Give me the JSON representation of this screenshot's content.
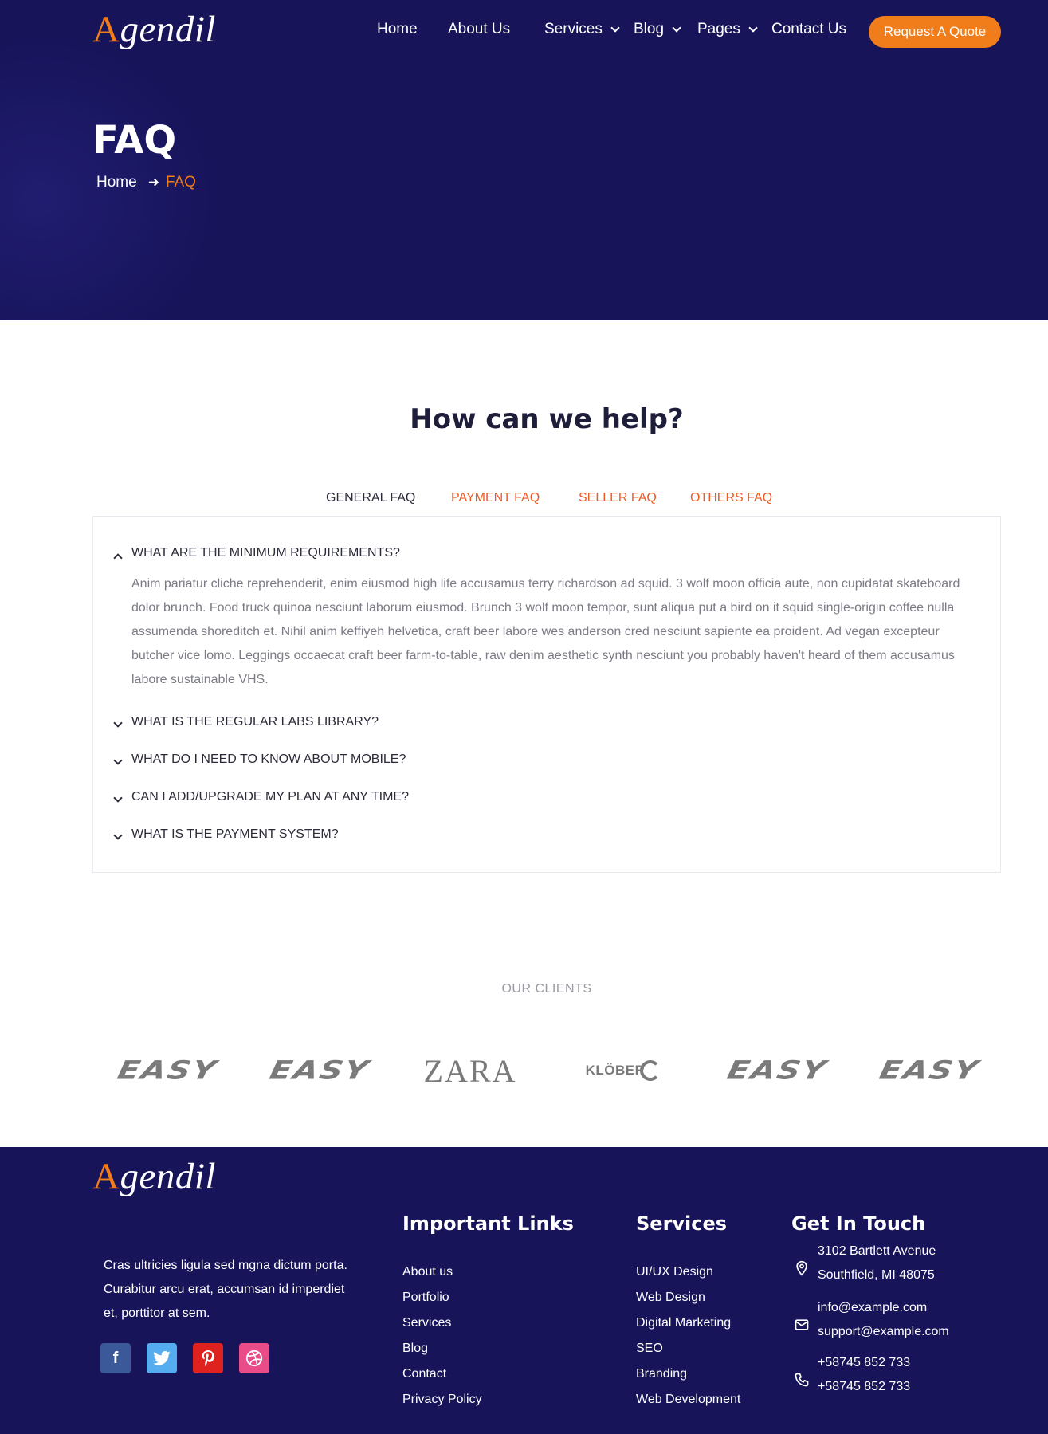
{
  "brand": {
    "logo_initial": "A",
    "logo_rest": "gendil",
    "accent_color": "#f07d1a",
    "navy_color": "#17145a",
    "tab_color": "#ee5a24"
  },
  "nav": {
    "items": [
      {
        "label": "Home"
      },
      {
        "label": "About Us"
      },
      {
        "label": "Services",
        "dropdown": true
      },
      {
        "label": "Blog",
        "dropdown": true
      },
      {
        "label": "Pages",
        "dropdown": true
      },
      {
        "label": "Contact Us"
      }
    ],
    "cta_label": "Request A Quote"
  },
  "hero": {
    "title": "FAQ",
    "breadcrumb_home": "Home",
    "breadcrumb_current": "FAQ"
  },
  "faq": {
    "heading": "How can we help?",
    "tabs": [
      "GENERAL FAQ",
      "PAYMENT FAQ",
      "SELLER FAQ",
      "OTHERS FAQ"
    ],
    "active_tab": "GENERAL FAQ",
    "questions": [
      {
        "q": "WHAT ARE THE MINIMUM REQUIREMENTS?",
        "expanded": true
      },
      {
        "q": "WHAT IS THE REGULAR LABS LIBRARY?",
        "expanded": false
      },
      {
        "q": "WHAT DO I NEED TO KNOW ABOUT MOBILE?",
        "expanded": false
      },
      {
        "q": "CAN I ADD/UPGRADE MY PLAN AT ANY TIME?",
        "expanded": false
      },
      {
        "q": "WHAT IS THE PAYMENT SYSTEM?",
        "expanded": false
      }
    ],
    "answer": "Anim pariatur cliche reprehenderit, enim eiusmod high life accusamus terry richardson ad squid. 3 wolf moon officia aute, non cupidatat skateboard dolor brunch. Food truck quinoa nesciunt laborum eiusmod. Brunch 3 wolf moon tempor, sunt aliqua put a bird on it squid single-origin coffee nulla assumenda shoreditch et. Nihil anim keffiyeh helvetica, craft beer labore wes anderson cred nesciunt sapiente ea proident. Ad vegan excepteur butcher vice lomo. Leggings occaecat craft beer farm-to-table, raw denim aesthetic synth nesciunt you probably haven't heard of them accusamus labore sustainable VHS."
  },
  "clients": {
    "heading": "OUR CLIENTS",
    "logos": [
      "EASY",
      "EASY",
      "ZARA",
      "KLÖBER",
      "EASY",
      "EASY"
    ]
  },
  "footer": {
    "description": "Cras ultricies ligula sed mgna dictum porta. Curabitur arcu erat, accumsan id imperdiet et, porttitor at sem.",
    "social": [
      {
        "icon": "facebook-icon",
        "glyph": "f",
        "color": "#3b5998"
      },
      {
        "icon": "twitter-icon",
        "glyph": "t",
        "color": "#55acee"
      },
      {
        "icon": "pinterest-icon",
        "glyph": "p",
        "color": "#e0221f"
      },
      {
        "icon": "dribbble-icon",
        "glyph": "d",
        "color": "#ea4c89"
      }
    ],
    "important_links": {
      "title": "Important Links",
      "items": [
        "About us",
        "Portfolio",
        "Services",
        "Blog",
        "Contact",
        "Privacy Policy"
      ]
    },
    "services": {
      "title": "Services",
      "items": [
        "UI/UX Design",
        "Web Design",
        "Digital Marketing",
        "SEO",
        "Branding",
        "Web Development"
      ]
    },
    "contact": {
      "title": "Get In Touch",
      "address": [
        "3102 Bartlett Avenue",
        "Southfield, MI 48075"
      ],
      "emails": [
        "info@example.com",
        "support@example.com"
      ],
      "phones": [
        "+58745 852 733",
        "+58745 852 733"
      ]
    }
  }
}
